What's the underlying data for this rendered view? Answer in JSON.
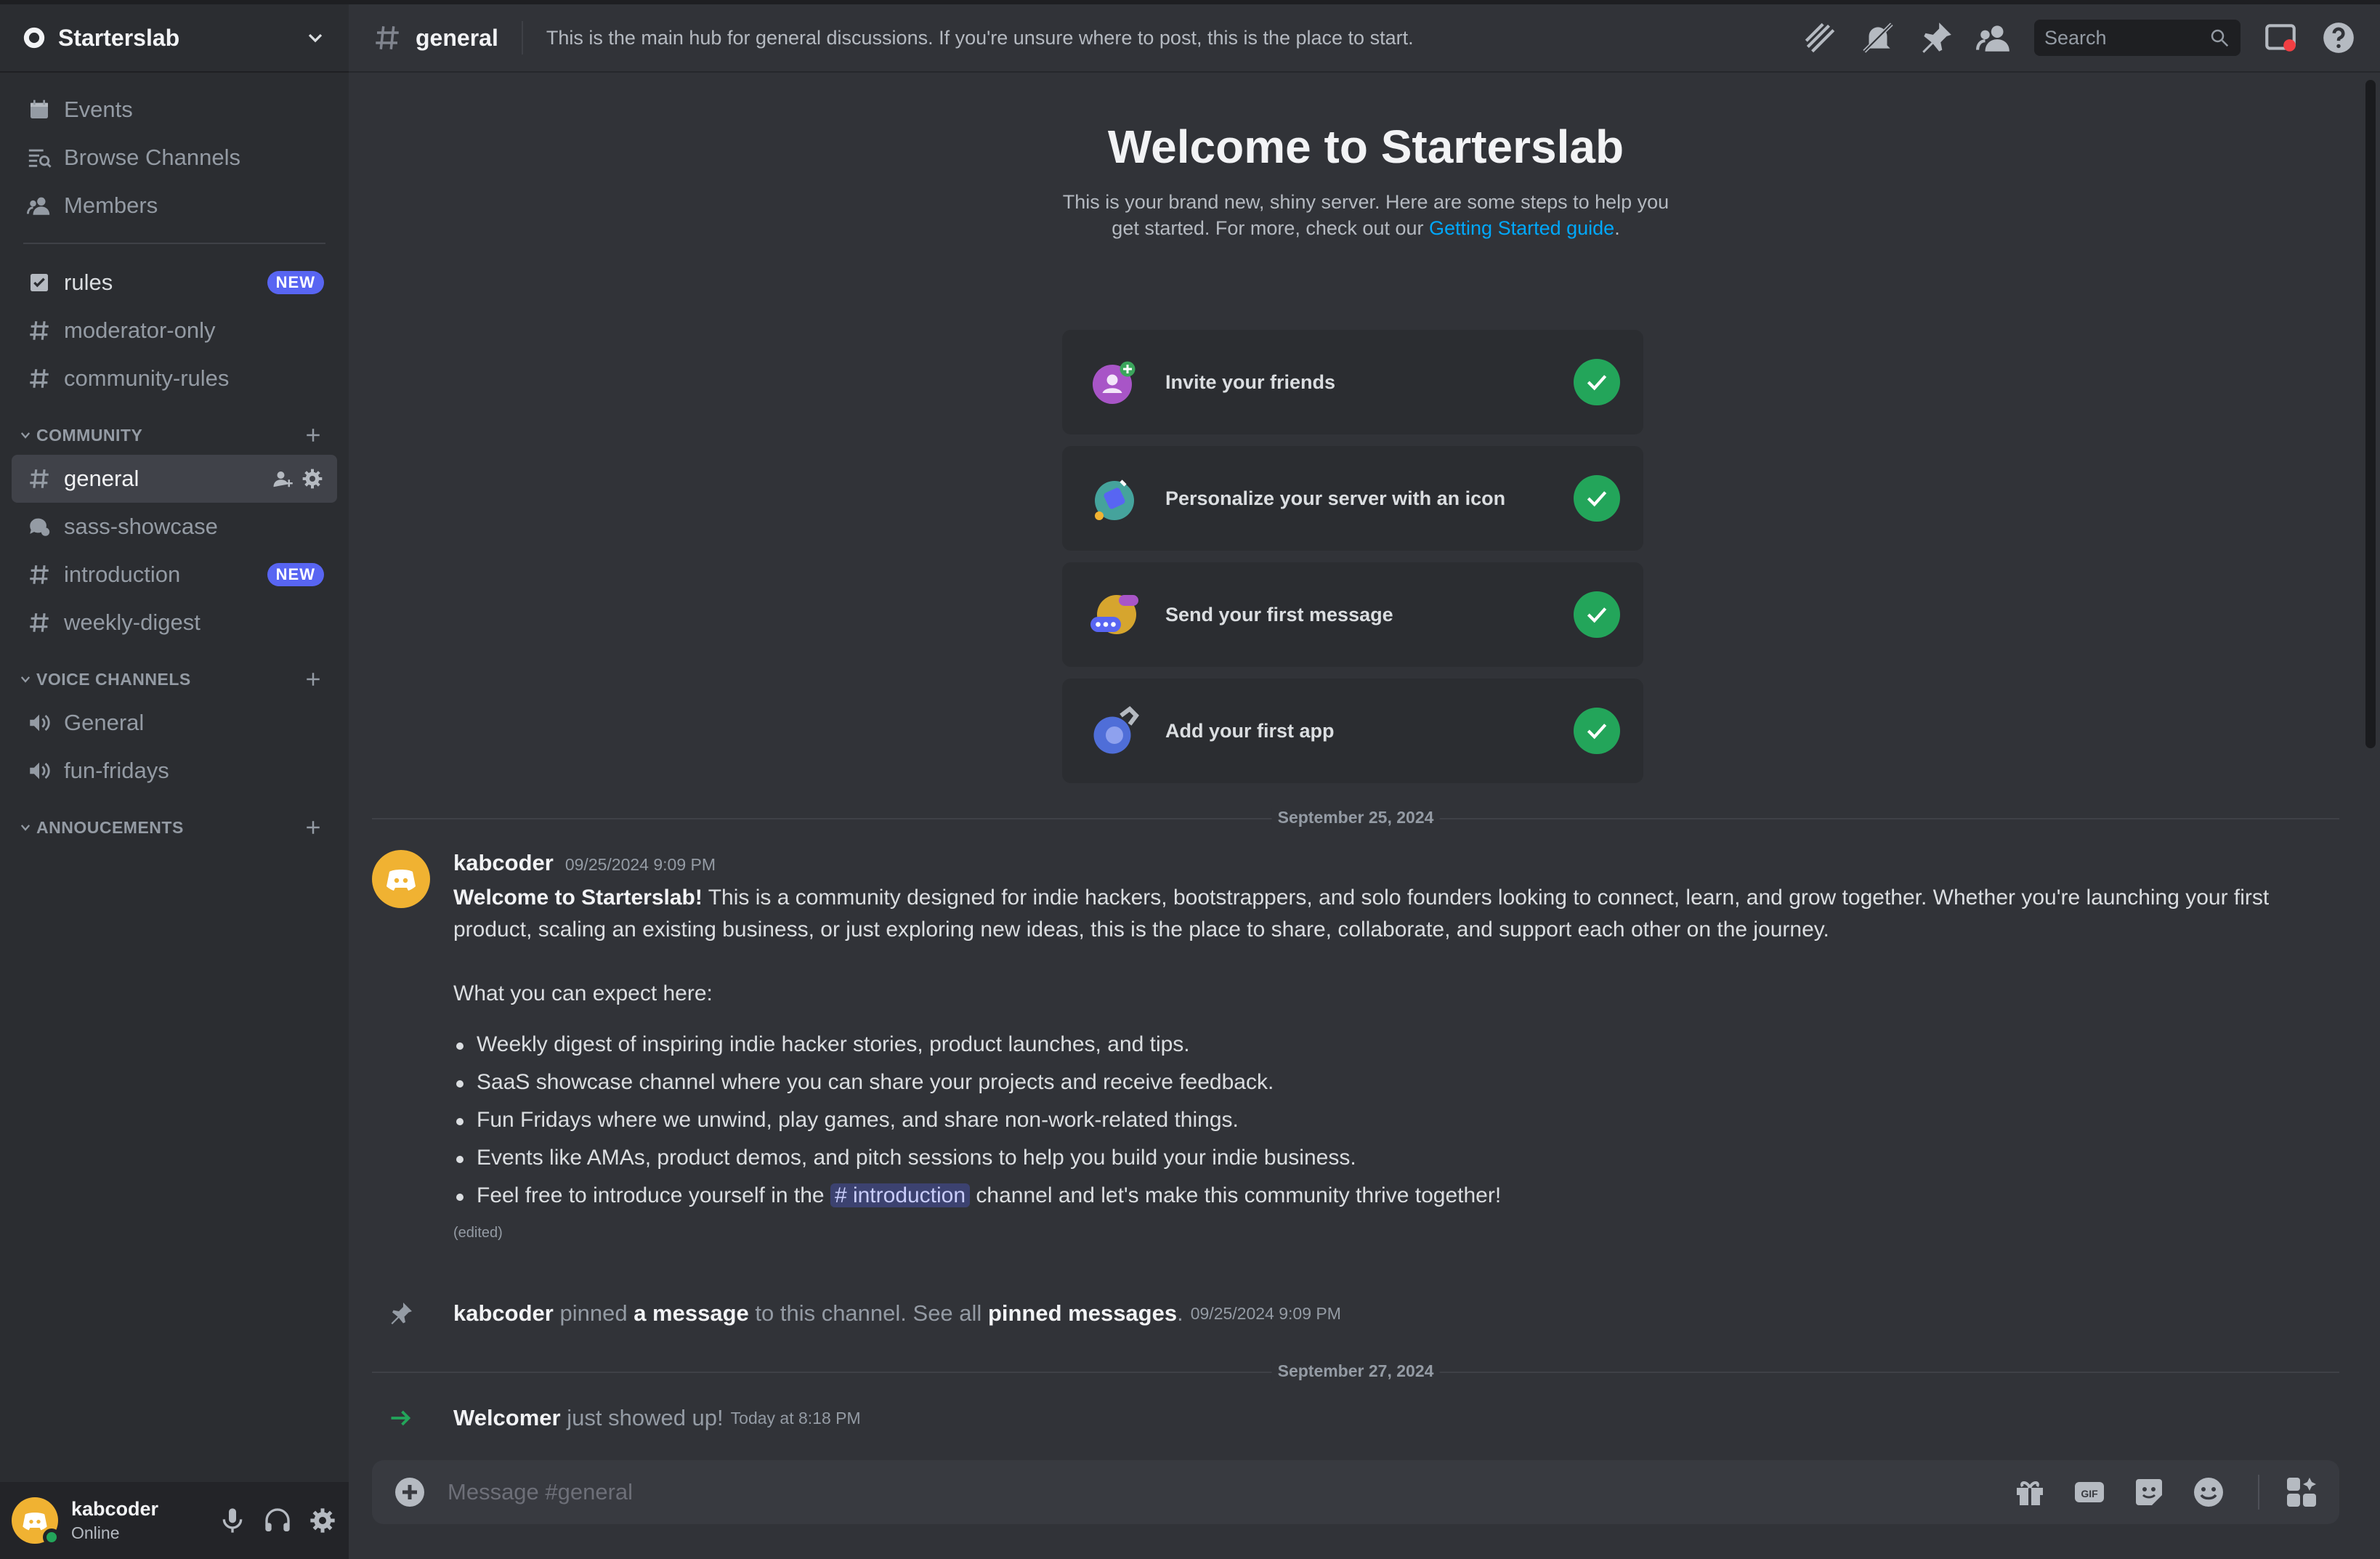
{
  "server": {
    "name": "Starterslab"
  },
  "sidebar": {
    "top_items": [
      {
        "label": "Events",
        "icon": "calendar-icon"
      },
      {
        "label": "Browse Channels",
        "icon": "browse-channels-icon"
      },
      {
        "label": "Members",
        "icon": "members-icon"
      }
    ],
    "pinned_channels": [
      {
        "label": "rules",
        "badge": "NEW",
        "icon": "rules-icon"
      },
      {
        "label": "moderator-only",
        "icon": "hash-icon"
      },
      {
        "label": "community-rules",
        "icon": "hash-icon"
      }
    ],
    "categories": [
      {
        "label": "COMMUNITY",
        "channels": [
          {
            "label": "general",
            "active": true
          },
          {
            "label": "sass-showcase",
            "icon": "forum-icon"
          },
          {
            "label": "introduction",
            "badge": "NEW"
          },
          {
            "label": "weekly-digest"
          }
        ]
      },
      {
        "label": "VOICE CHANNELS",
        "channels": [
          {
            "label": "General",
            "icon": "speaker-icon"
          },
          {
            "label": "fun-fridays",
            "icon": "speaker-icon"
          }
        ]
      },
      {
        "label": "ANNOUCEMENTS",
        "channels": []
      }
    ]
  },
  "user": {
    "name": "kabcoder",
    "status": "Online"
  },
  "header": {
    "channel": "general",
    "topic": "This is the main hub for general discussions. If you're unsure where to post, this is the place to start.",
    "search_placeholder": "Search"
  },
  "welcome": {
    "title": "Welcome to Starterslab",
    "text": "This is your brand new, shiny server. Here are some steps to help you get started. For more, check out our",
    "link": "Getting Started guide",
    "tasks": [
      {
        "label": "Invite your friends",
        "done": true
      },
      {
        "label": "Personalize your server with an icon",
        "done": true
      },
      {
        "label": "Send your first message",
        "done": true
      },
      {
        "label": "Add your first app",
        "done": true
      }
    ]
  },
  "messages": {
    "date1": "September 25, 2024",
    "first": {
      "author": "kabcoder",
      "timestamp": "09/25/2024 9:09 PM",
      "bold_intro": "Welcome to Starterslab!",
      "intro": "This is a community designed for indie hackers, bootstrappers, and solo founders looking to connect, learn, and grow together. Whether you're launching your first product, scaling an existing business, or just exploring new ideas, this is the place to share, collaborate, and support each other on the journey.",
      "expect": "What you can expect here:",
      "bullets": [
        "Weekly digest of inspiring indie hacker stories, product launches, and tips.",
        "SaaS showcase channel where you can share your projects and receive feedback.",
        "Fun Fridays where we unwind, play games, and share non-work-related things.",
        "Events like AMAs, product demos, and pitch sessions to help you build your indie business."
      ],
      "last_bullet_pre": "Feel free to introduce yourself in the",
      "last_bullet_mention": "# introduction",
      "last_bullet_post": "channel and let's make this community thrive together!",
      "edited": "(edited)"
    },
    "pinned": {
      "author": "kabcoder",
      "t1": "pinned",
      "link1": "a message",
      "t2": "to this channel. See all",
      "link2": "pinned messages",
      "t3": ".",
      "timestamp": "09/25/2024 9:09 PM"
    },
    "date2": "September 27, 2024",
    "join": {
      "author": "Welcomer",
      "text": "just showed up!",
      "timestamp": "Today at 8:18 PM"
    }
  },
  "composer": {
    "placeholder": "Message #general"
  },
  "colors": {
    "accent": "#5865f2",
    "success": "#23a55a",
    "link": "#00a8fc",
    "avatar": "#f0b232"
  }
}
